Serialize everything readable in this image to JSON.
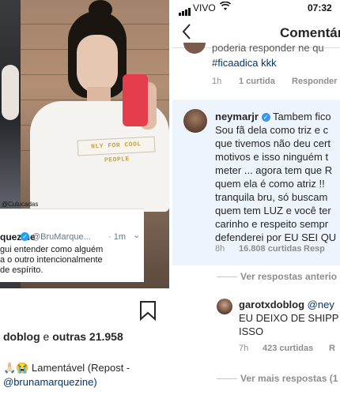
{
  "post": {
    "watermark": "@Cutucadas",
    "tweet": {
      "name_fragment": "quezine",
      "verified_mark": "✓",
      "handle": "@BruMarque...",
      "time": "· 1m",
      "chevron": "⌄",
      "lines": [
        "gui entender como alguém",
        "a o outro intencionalmente",
        "de espírito."
      ]
    },
    "shirt_print": "NLY FOR COOL PEOPLE",
    "likes": {
      "prefix": "doblog",
      "connector": " e ",
      "count": "outras 21.958"
    },
    "caption_line1": "🙏🏻😭 Lamentável (Repost -",
    "caption_line2": "@brunamarquezine)",
    "icons": {
      "bookmark": "bookmark-icon"
    }
  },
  "status_bar": {
    "carrier": "VIVO",
    "time": "07:32"
  },
  "nav": {
    "title": "Comentár",
    "back_icon": "chevron-left-icon"
  },
  "comments": {
    "top": {
      "line1": "poderia responder ne qu",
      "hashtag_line": "#ficaadica kkk",
      "time": "1h",
      "likes": "1 curtida",
      "reply": "Responder"
    },
    "neymar": {
      "username": "neymarjr",
      "verified_mark": "✓",
      "first_line_text": "Tambem fico",
      "lines": [
        "Sou fã dela como triz e c",
        "que tivemos não deu cert",
        "motivos e isso ninguém t",
        "meter ... agora tem que R",
        "quem ela é como atriz !! ",
        "tranquila bru, só buscam",
        "quem tem LUZ e você ter",
        "carinho e respeito sempr",
        "defenderei por EU SEI QU"
      ],
      "time": "8h",
      "likes": "16.808 curtidas",
      "reply": "Resp"
    },
    "view_previous": "Ver respostas anterio",
    "garoto": {
      "username": "garotxdoblog",
      "mention": "@ney",
      "lines": [
        "EU DEIXO DE SHIPP",
        "ISSO"
      ],
      "time": "7h",
      "likes": "423 curtidas",
      "reply": "R"
    },
    "view_more": "Ver mais respostas (1"
  },
  "colors": {
    "highlight_bg": "#eef4fb",
    "link_blue": "#00376b",
    "verified_blue": "#3897f0",
    "meta_gray": "#8e8e8e"
  }
}
